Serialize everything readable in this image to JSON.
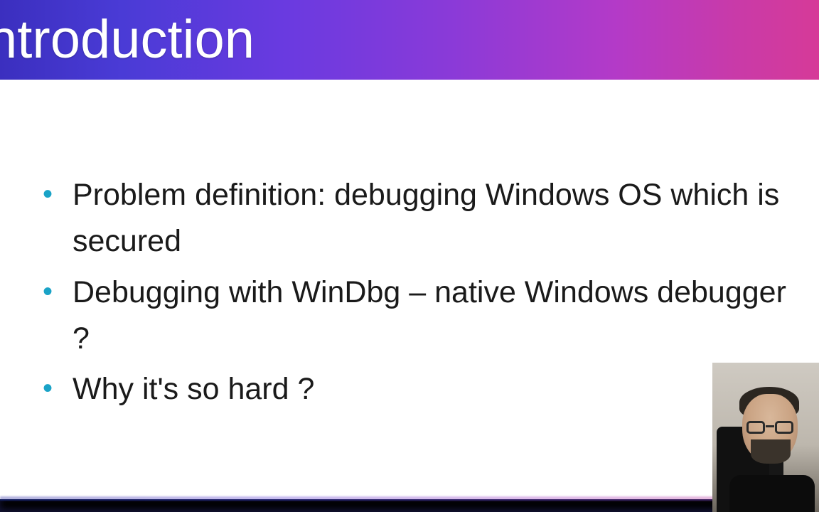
{
  "slide": {
    "title": "ntroduction",
    "bullets": [
      "Problem definition: debugging Windows OS which is secured",
      "Debugging with WinDbg – native Windows debugger ?",
      "Why it's so hard ?"
    ]
  }
}
